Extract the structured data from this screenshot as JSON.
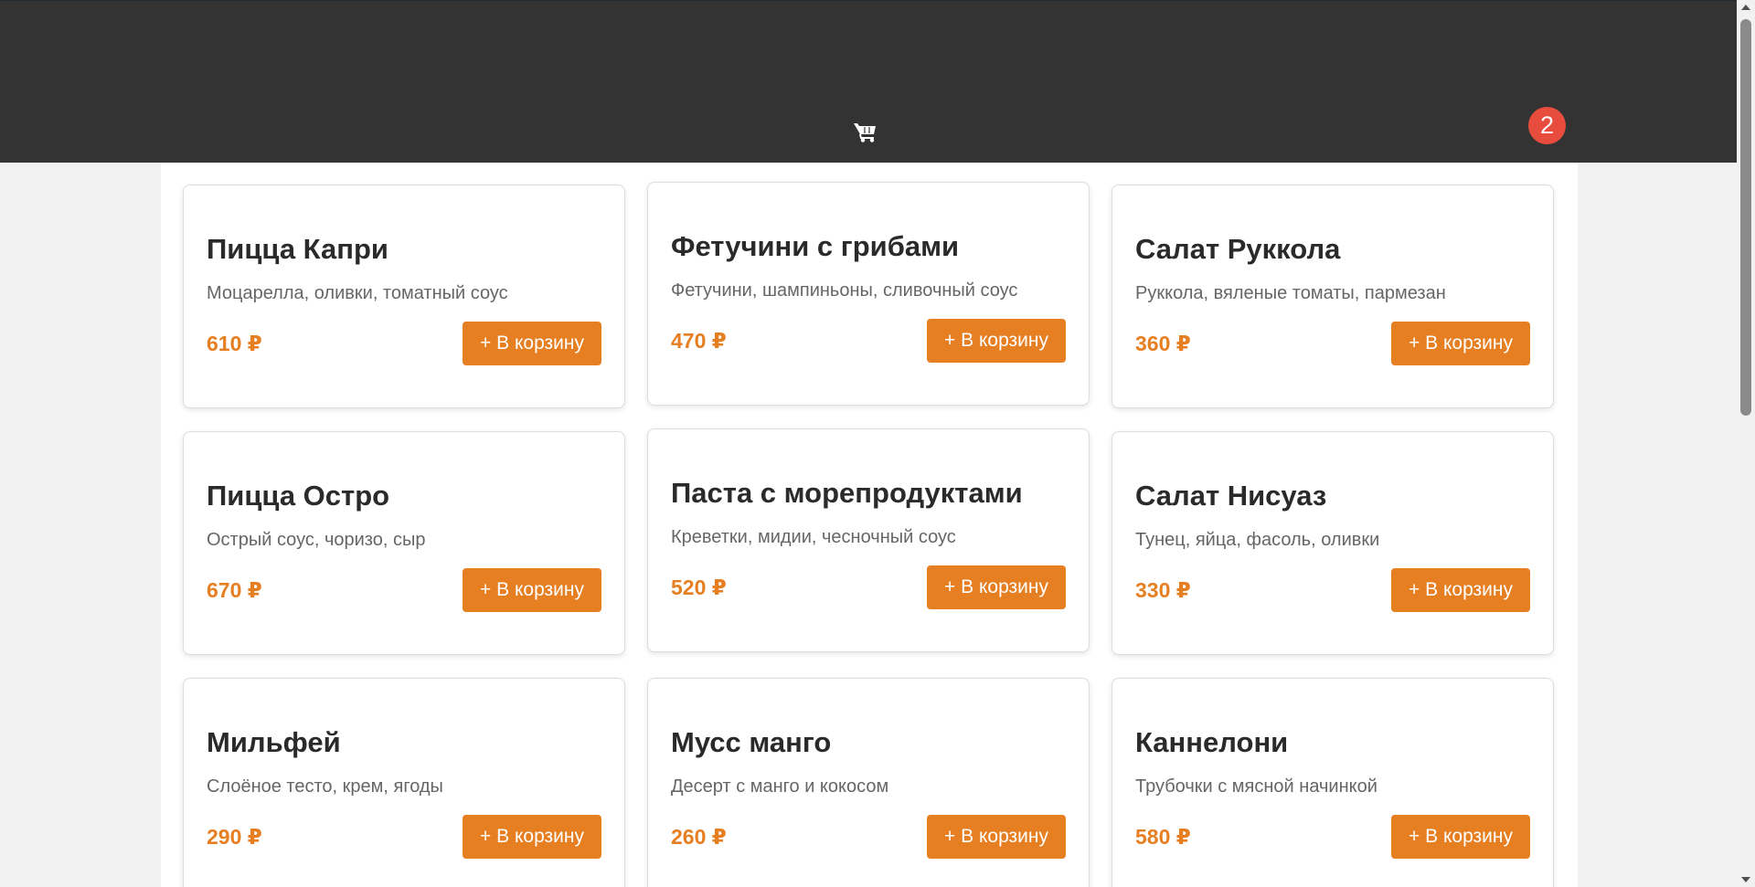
{
  "header": {
    "cart_icon": "cart-icon",
    "cart_count": "2",
    "background_color": "#333333",
    "badge_color": "#e74c3c"
  },
  "accent_color": "#e67e22",
  "menu": {
    "items": [
      {
        "name": "Пицца Капри",
        "description": "Моцарелла, оливки, томатный соус",
        "price": "610 ₽",
        "button": "+ В корзину"
      },
      {
        "name": "Фетучини с грибами",
        "description": "Фетучини, шампиньоны, сливочный соус",
        "price": "470 ₽",
        "button": "+ В корзину"
      },
      {
        "name": "Салат Руккола",
        "description": "Руккола, вяленые томаты, пармезан",
        "price": "360 ₽",
        "button": "+ В корзину"
      },
      {
        "name": "Пицца Остро",
        "description": "Острый соус, чоризо, сыр",
        "price": "670 ₽",
        "button": "+ В корзину"
      },
      {
        "name": "Паста с морепродуктами",
        "description": "Креветки, мидии, чесночный соус",
        "price": "520 ₽",
        "button": "+ В корзину"
      },
      {
        "name": "Салат Нисуаз",
        "description": "Тунец, яйца, фасоль, оливки",
        "price": "330 ₽",
        "button": "+ В корзину"
      },
      {
        "name": "Мильфей",
        "description": "Слоёное тесто, крем, ягоды",
        "price": "290 ₽",
        "button": "+ В корзину"
      },
      {
        "name": "Мусс манго",
        "description": "Десерт с манго и кокосом",
        "price": "260 ₽",
        "button": "+ В корзину"
      },
      {
        "name": "Каннелони",
        "description": "Трубочки с мясной начинкой",
        "price": "580 ₽",
        "button": "+ В корзину"
      }
    ]
  }
}
